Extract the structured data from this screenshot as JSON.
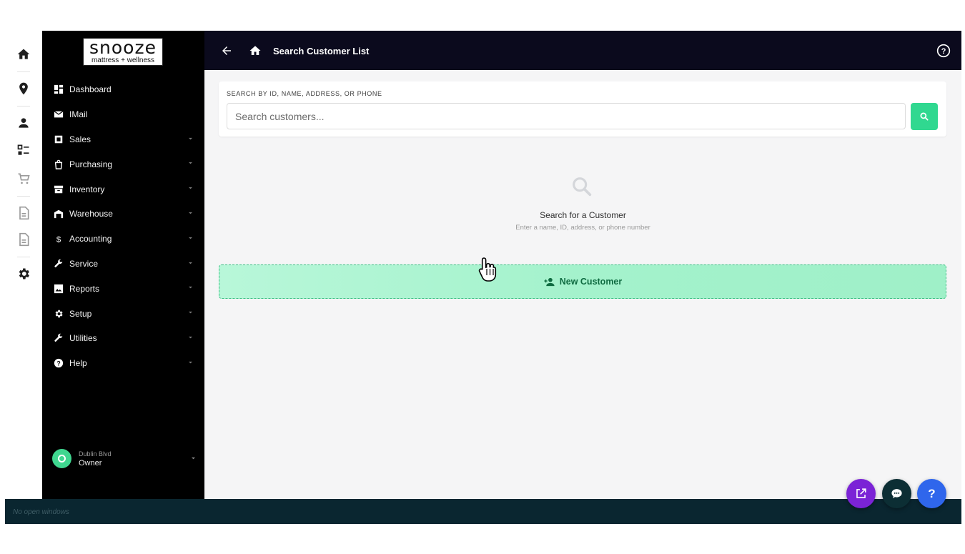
{
  "app": {
    "logo": {
      "brand": "snooze",
      "tagline": "mattress + wellness"
    },
    "rail": [
      "home-icon",
      "location-pin-icon",
      "person-icon",
      "checklist-icon",
      "cart-icon",
      "document-icon",
      "document-icon",
      "gear-icon"
    ]
  },
  "sidebar": {
    "items": [
      {
        "label": "Dashboard",
        "icon": "dashboard-icon",
        "has_submenu": false
      },
      {
        "label": "IMail",
        "icon": "mail-icon",
        "has_submenu": false
      },
      {
        "label": "Sales",
        "icon": "sales-icon",
        "has_submenu": true
      },
      {
        "label": "Purchasing",
        "icon": "bag-icon",
        "has_submenu": true
      },
      {
        "label": "Inventory",
        "icon": "archive-icon",
        "has_submenu": true
      },
      {
        "label": "Warehouse",
        "icon": "warehouse-icon",
        "has_submenu": true
      },
      {
        "label": "Accounting",
        "icon": "dollar-icon",
        "has_submenu": true
      },
      {
        "label": "Service",
        "icon": "wrench-icon",
        "has_submenu": true
      },
      {
        "label": "Reports",
        "icon": "image-icon",
        "has_submenu": true
      },
      {
        "label": "Setup",
        "icon": "gear-icon",
        "has_submenu": true
      },
      {
        "label": "Utilities",
        "icon": "wrench-icon",
        "has_submenu": true
      },
      {
        "label": "Help",
        "icon": "help-circle-icon",
        "has_submenu": true
      }
    ],
    "user": {
      "location": "Dublin Blvd",
      "role": "Owner"
    }
  },
  "header": {
    "title": "Search Customer List"
  },
  "search": {
    "label": "SEARCH BY ID, NAME, ADDRESS, OR PHONE",
    "placeholder": "Search customers...",
    "value": ""
  },
  "empty_state": {
    "title": "Search for a Customer",
    "subtitle": "Enter a name, ID, address, or phone number"
  },
  "new_customer": {
    "label": "New Customer"
  },
  "taskbar": {
    "status": "No open windows"
  },
  "colors": {
    "accent_green": "#30d890",
    "topbar": "#0b0a1d",
    "sidebar": "#000000",
    "fab_external": "#7b23d6",
    "fab_chat": "#0c2e34",
    "fab_help": "#2f66ec"
  }
}
